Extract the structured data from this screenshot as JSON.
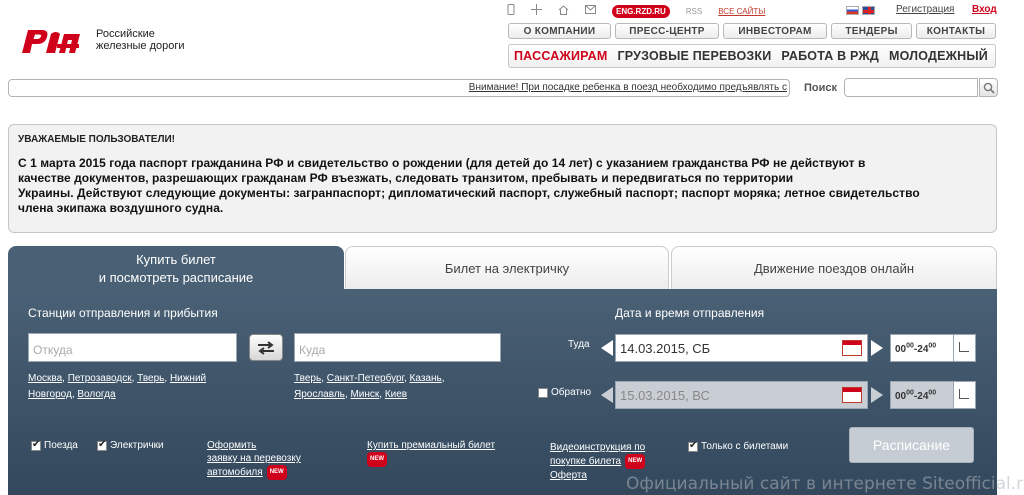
{
  "brand": {
    "line1": "Российские",
    "line2": "железные дороги",
    "logo_color": "#d0021b"
  },
  "toolbar": {
    "icons": [
      "mobile-icon",
      "sitemap-icon",
      "home-icon",
      "mail-icon"
    ],
    "eng_label": "ENG.RZD.RU",
    "rss_label": "RSS",
    "all_sites_label": "ВСЕ САЙТЫ",
    "registration_label": "Регистрация",
    "login_label": "Вход"
  },
  "nav_top": [
    "О КОМПАНИИ",
    "ПРЕСС-ЦЕНТР",
    "ИНВЕСТОРАМ",
    "ТЕНДЕРЫ",
    "КОНТАКТЫ"
  ],
  "nav_main": {
    "items": [
      "ПАССАЖИРАМ",
      "ГРУЗОВЫЕ ПЕРЕВОЗКИ",
      "РАБОТА В РЖД",
      "МОЛОДЕЖНЫЙ"
    ],
    "active_color": "#d0021b"
  },
  "ticker": {
    "text": "Внимание! При посадке ребенка в поезд необходимо предъявлять с"
  },
  "search": {
    "label": "Поиск",
    "value": ""
  },
  "notice": {
    "title": "УВАЖАЕМЫЕ ПОЛЬЗОВАТЕЛИ!",
    "line1": "С 1 марта 2015 года паспорт гражданина РФ и свидетельство о рождении (для детей до 14 лет) с указанием гражданства РФ не действуют в",
    "line2": "качестве документов, разрешающих гражданам РФ въезжать, следовать транзитом, пребывать и передвигаться по территории",
    "line3": "Украины. Действуют следующие документы: загранпаспорт;  дипломатический паспорт, служебный паспорт; паспорт моряка; летное свидетельство",
    "line4": "члена экипажа воздушного судна."
  },
  "tabs": {
    "buy_line1": "Купить билет",
    "buy_line2": "и посмотреть расписание",
    "suburban": "Билет на электричку",
    "online": "Движение поездов онлайн"
  },
  "booking": {
    "stations_label": "Станции отправления и прибытия",
    "from_placeholder": "Откуда",
    "to_placeholder": "Куда",
    "from_cities": {
      "moscow": "Москва",
      "petrozavodsk": "Петрозаводск",
      "tver": "Тверь",
      "nizhny": "Нижний",
      "novgorod": "Новгород",
      "vologda": "Вологда"
    },
    "to_cities": {
      "tver": "Тверь",
      "spb": "Санкт-Петербург",
      "kazan": "Казань",
      "yaroslavl": "Ярославль",
      "minsk": "Минск",
      "kiev": "Киев"
    },
    "datetime_label": "Дата и время отправления",
    "there_label": "Туда",
    "there_date": "14.03.2015, СБ",
    "back_label": "Обратно",
    "back_date": "15.03.2015, ВС",
    "time_from": "00",
    "time_to": "24",
    "trains_label": "Поезда",
    "suburban_label": "Электрички",
    "car_link_1": "Оформить",
    "car_link_2": "заявку на перевозку",
    "car_link_3": "автомобиля",
    "premium_link": "Купить премиальный билет",
    "video_link_1": "Видеоинструкция по",
    "video_link_2": "покупке билета",
    "video_link_3": "Оферта",
    "new_badge": "NEW",
    "only_tickets_label": "Только с билетами",
    "schedule_button": "Расписание"
  },
  "watermark": "Официальный сайт в интернете Siteofficial.ru"
}
